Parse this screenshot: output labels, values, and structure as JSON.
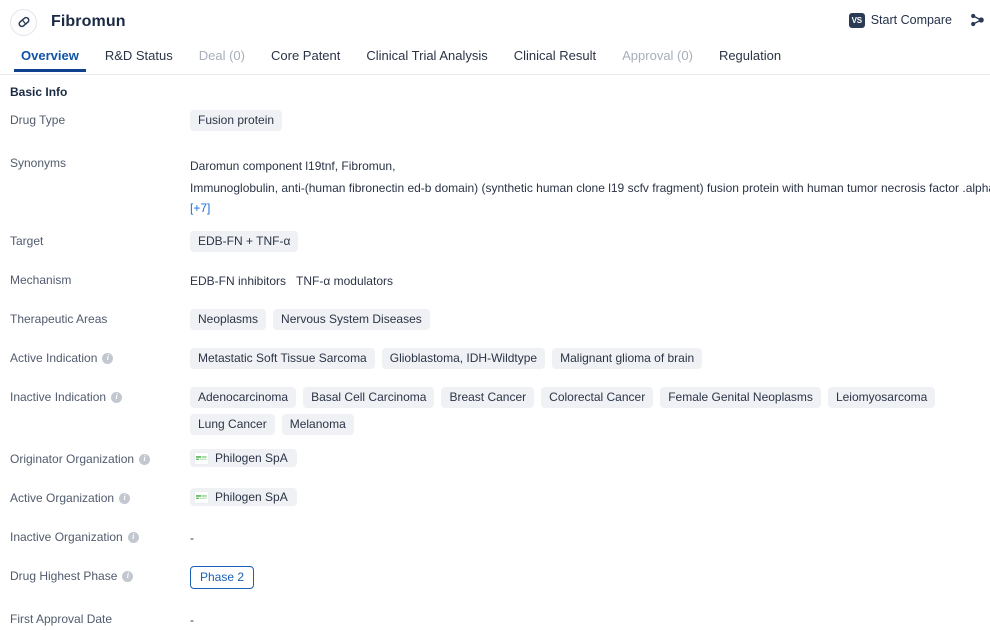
{
  "header": {
    "drug_name": "Fibromun",
    "drug_icon": "capsule-icon",
    "compare_badge": "VS",
    "compare_label": "Start Compare",
    "share_icon": "share-nodes-icon"
  },
  "tabs": [
    {
      "label": "Overview",
      "state": "active"
    },
    {
      "label": "R&D Status",
      "state": "normal"
    },
    {
      "label": "Deal (0)",
      "state": "disabled"
    },
    {
      "label": "Core Patent",
      "state": "normal"
    },
    {
      "label": "Clinical Trial Analysis",
      "state": "normal"
    },
    {
      "label": "Clinical Result",
      "state": "normal"
    },
    {
      "label": "Approval (0)",
      "state": "disabled"
    },
    {
      "label": "Regulation",
      "state": "normal"
    }
  ],
  "section": {
    "title": "Basic Info"
  },
  "fields": {
    "drug_type": {
      "label": "Drug Type",
      "tags": [
        "Fusion protein"
      ]
    },
    "synonyms": {
      "label": "Synonyms",
      "line1": "Daromun component l19tnf,  Fibromun,",
      "line2": "Immunoglobulin, anti-(human fibronectin ed-b domain) (synthetic human clone l19 scfv fragment) fusion protein with human tumor necrosis factor .alpha., trim",
      "more": "[+7]"
    },
    "target": {
      "label": "Target",
      "tags": [
        "EDB-FN + TNF-α"
      ]
    },
    "mechanism": {
      "label": "Mechanism",
      "items": [
        "EDB-FN inhibitors",
        "TNF-α modulators"
      ]
    },
    "therapeutic_areas": {
      "label": "Therapeutic Areas",
      "tags": [
        "Neoplasms",
        "Nervous System Diseases"
      ]
    },
    "active_indication": {
      "label": "Active Indication",
      "has_info": true,
      "tags": [
        "Metastatic Soft Tissue Sarcoma",
        "Glioblastoma, IDH-Wildtype",
        "Malignant glioma of brain"
      ]
    },
    "inactive_indication": {
      "label": "Inactive Indication",
      "has_info": true,
      "tags": [
        "Adenocarcinoma",
        "Basal Cell Carcinoma",
        "Breast Cancer",
        "Colorectal Cancer",
        "Female Genital Neoplasms",
        "Leiomyosarcoma",
        "Lung Cancer",
        "Melanoma"
      ]
    },
    "originator_organization": {
      "label": "Originator Organization",
      "has_info": true,
      "orgs": [
        "Philogen SpA"
      ]
    },
    "active_organization": {
      "label": "Active Organization",
      "has_info": true,
      "orgs": [
        "Philogen SpA"
      ]
    },
    "inactive_organization": {
      "label": "Inactive Organization",
      "has_info": true,
      "value": "-"
    },
    "drug_highest_phase": {
      "label": "Drug Highest Phase",
      "has_info": true,
      "badge": "Phase 2"
    },
    "first_approval_date": {
      "label": "First Approval Date",
      "value": "-"
    }
  },
  "colors": {
    "accent_blue": "#1154a8",
    "tab_underline": "#11408f",
    "link_blue": "#1a6fd4",
    "tag_bg": "#f0f1f4",
    "label_grey": "#515b6d",
    "disabled_grey": "#a8aebb"
  }
}
